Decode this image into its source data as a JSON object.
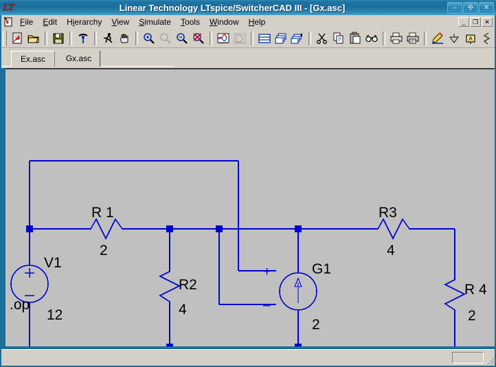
{
  "window": {
    "title": "Linear Technology LTspice/SwitcherCAD III - [Gx.asc]",
    "logo_text": "LT",
    "buttons": {
      "minimize": "–",
      "maximize": "✣",
      "close": "✕"
    },
    "mdi_buttons": {
      "minimize": "_",
      "restore": "❐",
      "close": "✕"
    }
  },
  "menubar": {
    "items": [
      {
        "label": "File",
        "mnemonic_index": 0
      },
      {
        "label": "Edit",
        "mnemonic_index": 0
      },
      {
        "label": "Hierarchy",
        "mnemonic_index": 1
      },
      {
        "label": "View",
        "mnemonic_index": 0
      },
      {
        "label": "Simulate",
        "mnemonic_index": 0
      },
      {
        "label": "Tools",
        "mnemonic_index": 0
      },
      {
        "label": "Window",
        "mnemonic_index": 0
      },
      {
        "label": "Help",
        "mnemonic_index": 0
      }
    ]
  },
  "toolbar": {
    "groups": [
      [
        "new-schematic",
        "open-file",
        "save-file",
        "run-build"
      ],
      [
        "run-simulation",
        "pan-hand"
      ],
      [
        "zoom-in-area",
        "zoom-pan-disabled",
        "zoom-out",
        "zoom-back-cancel"
      ],
      [
        "waveform-view",
        "spice-error-log"
      ],
      [
        "view-netlist",
        "copy-bitmap",
        "copy-bitmap-arrow"
      ],
      [
        "cut",
        "copy",
        "paste",
        "find"
      ],
      [
        "print-preview",
        "print"
      ],
      [
        "draw-wire",
        "place-ground",
        "place-label",
        "place-resistor",
        "place-capacitor",
        "place-inductor",
        "place-diode"
      ]
    ]
  },
  "tabs": {
    "items": [
      {
        "label": "Ex.asc",
        "active": false
      },
      {
        "label": "Gx.asc",
        "active": true
      }
    ]
  },
  "schematic": {
    "directive": ".op",
    "components": [
      {
        "name": "V1",
        "type": "voltage-source",
        "label": "V1",
        "value": "12"
      },
      {
        "name": "R1",
        "type": "resistor",
        "label": "R 1",
        "value": "2"
      },
      {
        "name": "R2",
        "type": "resistor",
        "label": "R2",
        "value": "4"
      },
      {
        "name": "R3",
        "type": "resistor",
        "label": "R3",
        "value": "4"
      },
      {
        "name": "R4",
        "type": "resistor",
        "label": "R 4",
        "value": "2"
      },
      {
        "name": "G1",
        "type": "vccs-source",
        "label": "G1",
        "value": "2"
      }
    ],
    "labels": {
      "v1_name": "V1",
      "v1_value": "12",
      "r1_name": "R 1",
      "r1_value": "2",
      "r2_name": "R2",
      "r2_value": "4",
      "r3_name": "R3",
      "r3_value": "4",
      "r4_name": "R 4",
      "r4_value": "2",
      "g1_name": "G1",
      "g1_value": "2",
      "source_plus": "+",
      "source_minus": "–",
      "g1_plus": "+",
      "g1_minus": "–"
    },
    "colors": {
      "wire": "#0000d0",
      "background": "#c0c0c0",
      "text": "#000000"
    }
  },
  "statusbar": {
    "text": ""
  }
}
